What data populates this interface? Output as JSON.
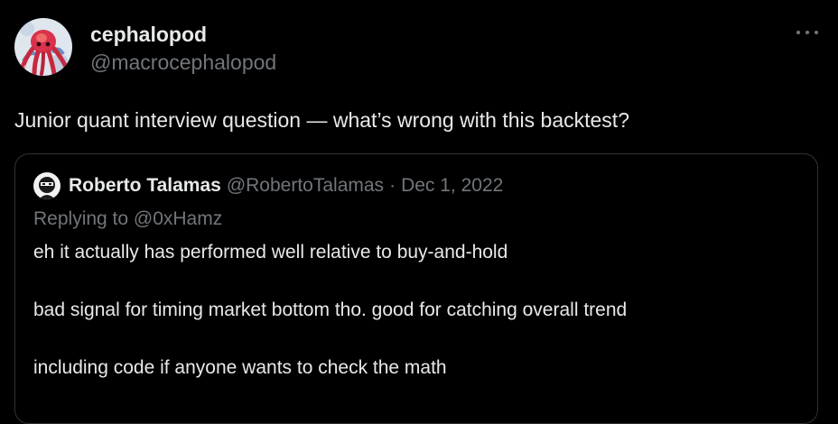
{
  "author": {
    "display_name": "cephalopod",
    "handle": "@macrocephalopod",
    "avatar_icon": "octopus-avatar-icon"
  },
  "more_icon": "more-options-icon",
  "tweet_text": "Junior quant interview question — what’s wrong with this backtest?",
  "quote": {
    "display_name": "Roberto Talamas",
    "handle": "@RobertoTalamas",
    "separator": "·",
    "date": "Dec 1, 2022",
    "replying_to": "Replying to @0xHamz",
    "lines": [
      "eh it actually has performed well relative to buy-and-hold",
      "bad signal for timing market bottom tho. good for catching overall trend",
      "including code if anyone wants to check the math"
    ]
  },
  "colors": {
    "background": "#000000",
    "primary_text": "#e7e9ea",
    "secondary_text": "#71767b",
    "border": "#2f3336"
  }
}
